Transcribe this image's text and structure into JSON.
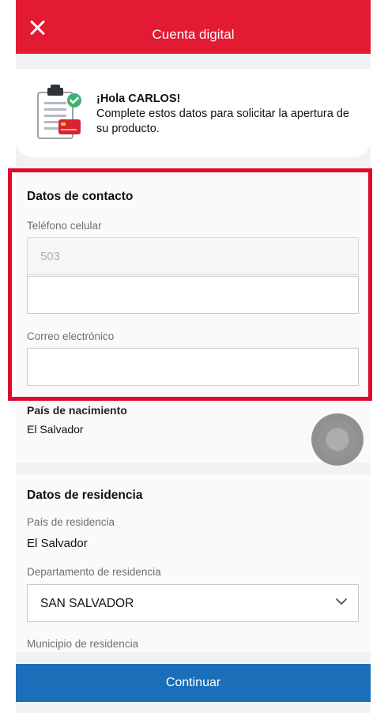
{
  "header": {
    "title": "Cuenta digital",
    "close_icon": "close-icon"
  },
  "greeting": {
    "hello": "¡Hola CARLOS!",
    "message": "Complete estos datos para solicitar la apertura de su producto."
  },
  "contact": {
    "title": "Datos de contacto",
    "phone_label": "Teléfono celular",
    "country_code": "503",
    "phone_value": "",
    "email_label": "Correo electrónico",
    "email_value": ""
  },
  "birth": {
    "label": "País de nacimiento",
    "value": "El Salvador"
  },
  "residence": {
    "title": "Datos de residencia",
    "country_label": "País de residencia",
    "country_value": "El Salvador",
    "department_label": "Departamento de residencia",
    "department_value": "SAN SALVADOR",
    "municipality_label": "Municipio de residencia"
  },
  "actions": {
    "continue_label": "Continuar"
  },
  "colors": {
    "header": "#e21a32",
    "highlight": "#e0092a",
    "button": "#1a6fb8"
  }
}
